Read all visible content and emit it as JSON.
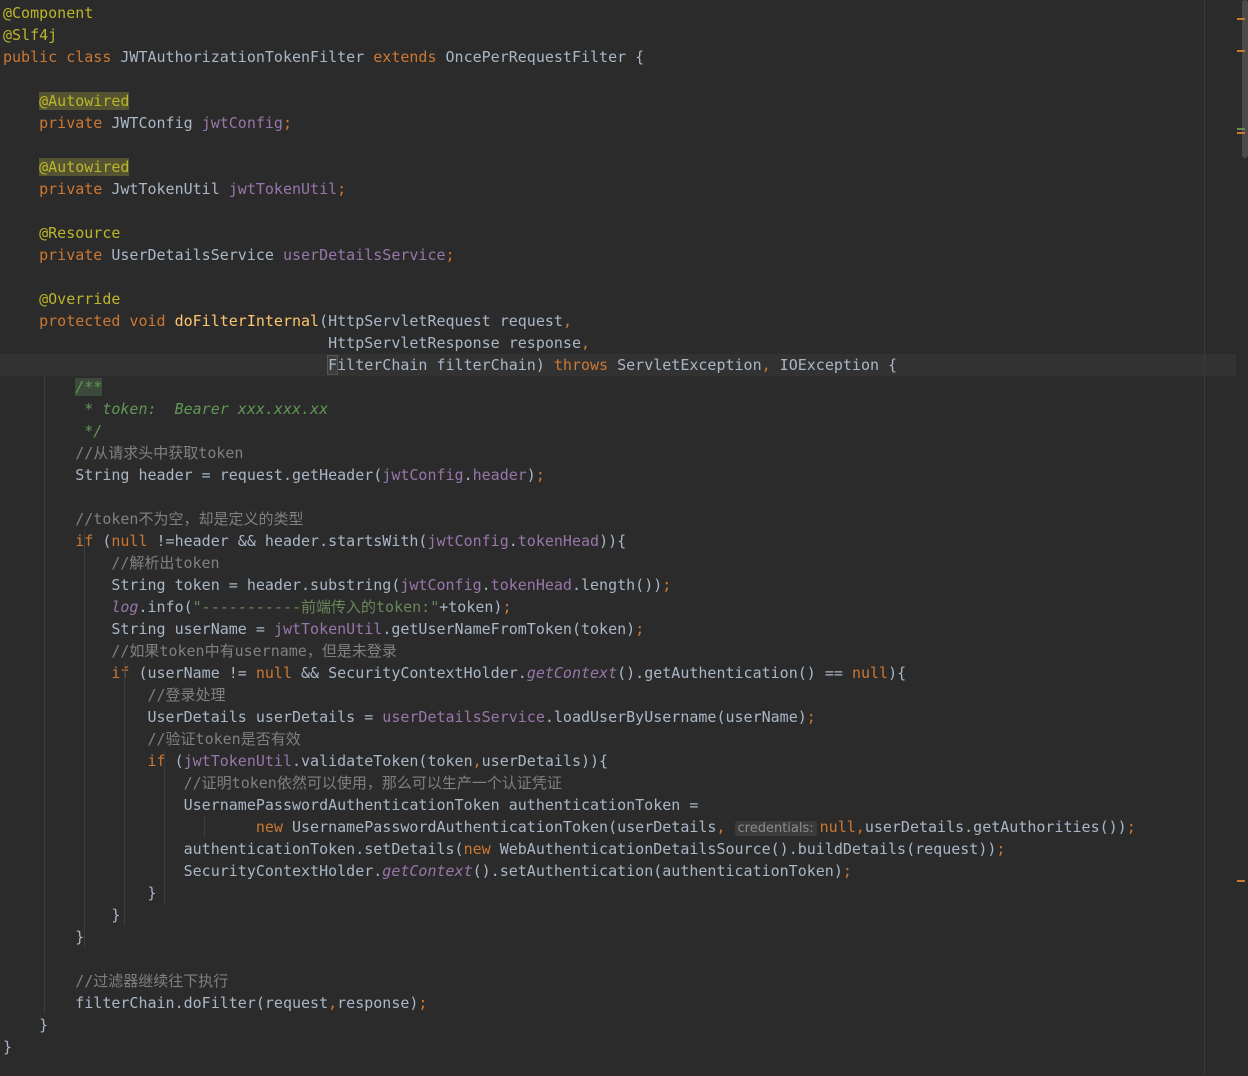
{
  "editor": {
    "lines": [
      [
        {
          "t": "@Component",
          "c": "an"
        }
      ],
      [
        {
          "t": "@Slf4j",
          "c": "an"
        }
      ],
      [
        {
          "t": "public class ",
          "c": "k"
        },
        {
          "t": "JWTAuthorizationTokenFilter ",
          "c": "p"
        },
        {
          "t": "extends ",
          "c": "k"
        },
        {
          "t": "OncePerRequestFilter {",
          "c": "p"
        }
      ],
      [],
      [
        {
          "t": "    ",
          "c": "p"
        },
        {
          "t": "@Autowired",
          "c": "an-hl"
        }
      ],
      [
        {
          "t": "    ",
          "c": "p"
        },
        {
          "t": "private ",
          "c": "k"
        },
        {
          "t": "JWTConfig ",
          "c": "p"
        },
        {
          "t": "jwtConfig",
          "c": "f"
        },
        {
          "t": ";",
          "c": "k"
        }
      ],
      [],
      [
        {
          "t": "    ",
          "c": "p"
        },
        {
          "t": "@Autowired",
          "c": "an-hl"
        }
      ],
      [
        {
          "t": "    ",
          "c": "p"
        },
        {
          "t": "private ",
          "c": "k"
        },
        {
          "t": "JwtTokenUtil ",
          "c": "p"
        },
        {
          "t": "jwtTokenUtil",
          "c": "f"
        },
        {
          "t": ";",
          "c": "k"
        }
      ],
      [],
      [
        {
          "t": "    ",
          "c": "p"
        },
        {
          "t": "@Resource",
          "c": "an"
        }
      ],
      [
        {
          "t": "    ",
          "c": "p"
        },
        {
          "t": "private ",
          "c": "k"
        },
        {
          "t": "UserDetailsService ",
          "c": "p"
        },
        {
          "t": "userDetailsService",
          "c": "f"
        },
        {
          "t": ";",
          "c": "k"
        }
      ],
      [],
      [
        {
          "t": "    ",
          "c": "p"
        },
        {
          "t": "@Override",
          "c": "an"
        }
      ],
      [
        {
          "t": "    ",
          "c": "p"
        },
        {
          "t": "protected void ",
          "c": "k"
        },
        {
          "t": "doFilterInternal",
          "c": "fn"
        },
        {
          "t": "(HttpServletRequest request",
          "c": "p"
        },
        {
          "t": ",",
          "c": "k"
        }
      ],
      [
        {
          "t": "                                    HttpServletResponse response",
          "c": "p"
        },
        {
          "t": ",",
          "c": "k"
        }
      ],
      [
        {
          "t": "                                    ",
          "c": "p"
        },
        {
          "t": "F",
          "c": "cursor-char"
        },
        {
          "t": "ilterChain filterChain) ",
          "c": "p"
        },
        {
          "t": "throws ",
          "c": "k"
        },
        {
          "t": "ServletException",
          "c": "p"
        },
        {
          "t": ", ",
          "c": "k"
        },
        {
          "t": "IOException {",
          "c": "p"
        }
      ],
      [
        {
          "t": "        ",
          "c": "p"
        },
        {
          "t": "/**",
          "c": "doc-hl"
        }
      ],
      [
        {
          "t": "         * token:  Bearer xxx.xxx.xx",
          "c": "doc"
        }
      ],
      [
        {
          "t": "         */",
          "c": "doc"
        }
      ],
      [
        {
          "t": "        //从请求头中获取token",
          "c": "cm"
        }
      ],
      [
        {
          "t": "        String header = request.getHeader(",
          "c": "p"
        },
        {
          "t": "jwtConfig",
          "c": "f"
        },
        {
          "t": ".",
          "c": "p"
        },
        {
          "t": "header",
          "c": "f"
        },
        {
          "t": ")",
          "c": "p"
        },
        {
          "t": ";",
          "c": "k"
        }
      ],
      [],
      [
        {
          "t": "        //token不为空，却是定义的类型",
          "c": "cm"
        }
      ],
      [
        {
          "t": "        ",
          "c": "p"
        },
        {
          "t": "if ",
          "c": "k"
        },
        {
          "t": "(",
          "c": "p"
        },
        {
          "t": "null ",
          "c": "k"
        },
        {
          "t": "!=header && header.startsWith(",
          "c": "p"
        },
        {
          "t": "jwtConfig",
          "c": "f"
        },
        {
          "t": ".",
          "c": "p"
        },
        {
          "t": "tokenHead",
          "c": "f"
        },
        {
          "t": ")){",
          "c": "p"
        }
      ],
      [
        {
          "t": "            //解析出token",
          "c": "cm"
        }
      ],
      [
        {
          "t": "            String token = header.substring(",
          "c": "p"
        },
        {
          "t": "jwtConfig",
          "c": "f"
        },
        {
          "t": ".",
          "c": "p"
        },
        {
          "t": "tokenHead",
          "c": "f"
        },
        {
          "t": ".length())",
          "c": "p"
        },
        {
          "t": ";",
          "c": "k"
        }
      ],
      [
        {
          "t": "            ",
          "c": "p"
        },
        {
          "t": "log",
          "c": "st"
        },
        {
          "t": ".info(",
          "c": "p"
        },
        {
          "t": "\"-----------前端传入的token:\"",
          "c": "str"
        },
        {
          "t": "+token)",
          "c": "p"
        },
        {
          "t": ";",
          "c": "k"
        }
      ],
      [
        {
          "t": "            String userName = ",
          "c": "p"
        },
        {
          "t": "jwtTokenUtil",
          "c": "f"
        },
        {
          "t": ".getUserNameFromToken(token)",
          "c": "p"
        },
        {
          "t": ";",
          "c": "k"
        }
      ],
      [
        {
          "t": "            //如果token中有username，但是未登录",
          "c": "cm"
        }
      ],
      [
        {
          "t": "            ",
          "c": "p"
        },
        {
          "t": "if ",
          "c": "k"
        },
        {
          "t": "(userName != ",
          "c": "p"
        },
        {
          "t": "null ",
          "c": "k"
        },
        {
          "t": "&& SecurityContextHolder.",
          "c": "p"
        },
        {
          "t": "getContext",
          "c": "st"
        },
        {
          "t": "().getAuthentication() == ",
          "c": "p"
        },
        {
          "t": "null",
          "c": "k"
        },
        {
          "t": "){",
          "c": "p"
        }
      ],
      [
        {
          "t": "                //登录处理",
          "c": "cm"
        }
      ],
      [
        {
          "t": "                UserDetails userDetails = ",
          "c": "p"
        },
        {
          "t": "userDetailsService",
          "c": "f"
        },
        {
          "t": ".loadUserByUsername(userName)",
          "c": "p"
        },
        {
          "t": ";",
          "c": "k"
        }
      ],
      [
        {
          "t": "                //验证token是否有效",
          "c": "cm"
        }
      ],
      [
        {
          "t": "                ",
          "c": "p"
        },
        {
          "t": "if ",
          "c": "k"
        },
        {
          "t": "(",
          "c": "p"
        },
        {
          "t": "jwtTokenUtil",
          "c": "f"
        },
        {
          "t": ".validateToken(token",
          "c": "p"
        },
        {
          "t": ",",
          "c": "k"
        },
        {
          "t": "userDetails)){",
          "c": "p"
        }
      ],
      [
        {
          "t": "                    //证明token依然可以使用，那么可以生产一个认证凭证",
          "c": "cm"
        }
      ],
      [
        {
          "t": "                    UsernamePasswordAuthenticationToken authenticationToken =",
          "c": "p"
        }
      ],
      [
        {
          "t": "                            ",
          "c": "p"
        },
        {
          "t": "new ",
          "c": "k"
        },
        {
          "t": "UsernamePasswordAuthenticationToken(userDetails",
          "c": "p"
        },
        {
          "t": ", ",
          "c": "k"
        },
        {
          "t": "credentials:",
          "c": "hint"
        },
        {
          "t": "null",
          "c": "k"
        },
        {
          "t": ",",
          "c": "k"
        },
        {
          "t": "userDetails.getAuthorities())",
          "c": "p"
        },
        {
          "t": ";",
          "c": "k"
        }
      ],
      [
        {
          "t": "                    authenticationToken.setDetails(",
          "c": "p"
        },
        {
          "t": "new ",
          "c": "k"
        },
        {
          "t": "WebAuthenticationDetailsSource().buildDetails(request))",
          "c": "p"
        },
        {
          "t": ";",
          "c": "k"
        }
      ],
      [
        {
          "t": "                    SecurityContextHolder.",
          "c": "p"
        },
        {
          "t": "getContext",
          "c": "st"
        },
        {
          "t": "().setAuthentication(authenticationToken)",
          "c": "p"
        },
        {
          "t": ";",
          "c": "k"
        }
      ],
      [
        {
          "t": "                }",
          "c": "p"
        }
      ],
      [
        {
          "t": "            }",
          "c": "p"
        }
      ],
      [
        {
          "t": "        }",
          "c": "p"
        }
      ],
      [],
      [
        {
          "t": "        //过滤器继续往下执行",
          "c": "cm"
        }
      ],
      [
        {
          "t": "        filterChain.doFilter(request",
          "c": "p"
        },
        {
          "t": ",",
          "c": "k"
        },
        {
          "t": "response)",
          "c": "p"
        },
        {
          "t": ";",
          "c": "k"
        }
      ],
      [
        {
          "t": "    }",
          "c": "p"
        }
      ],
      [
        {
          "t": "}",
          "c": "p"
        }
      ]
    ],
    "current_line": 16
  },
  "colors": {
    "background": "#2b2b2b",
    "keyword": "#cc7832",
    "annotation": "#bbb529",
    "field": "#9876aa",
    "string": "#6a8759",
    "comment": "#808080",
    "doc_comment": "#629755",
    "method_declaration": "#ffc66d",
    "plain": "#a9b7c6"
  },
  "gutter_marks": [
    {
      "color": "#cc7832"
    },
    {
      "color": "#cc7832"
    },
    {
      "color": "#cc7832"
    },
    {
      "color": "#6a8759"
    },
    {
      "color": "#cc7832"
    }
  ]
}
